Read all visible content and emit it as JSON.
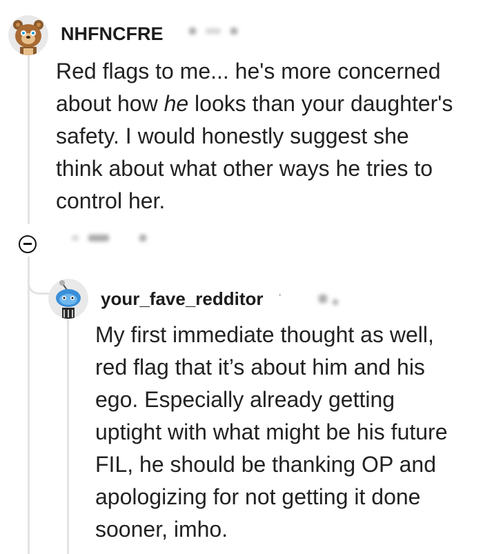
{
  "comments": [
    {
      "username": "NHFNCFRE",
      "avatar_icon": "snoo-bear-avatar-icon",
      "lines": [
        "Red flags to me... he's more concerned",
        "about how ",
        "he",
        " looks than your daughter's",
        "safety. I would honestly suggest she",
        "think about what other ways he tries to",
        "control her."
      ]
    },
    {
      "username": "your_fave_redditor",
      "avatar_icon": "snoo-blue-avatar-icon",
      "lines": [
        "My first immediate thought as well,",
        "red flag that it’s about him and his",
        "ego. Especially already getting",
        "uptight with what might be his future",
        "FIL, he should be thanking OP and",
        "apologizing for not getting it done",
        "sooner, imho."
      ]
    }
  ],
  "controls": {
    "collapse_icon": "collapse-minus-icon"
  },
  "colors": {
    "thread_line": "#e3e3e3",
    "text": "#222222"
  }
}
